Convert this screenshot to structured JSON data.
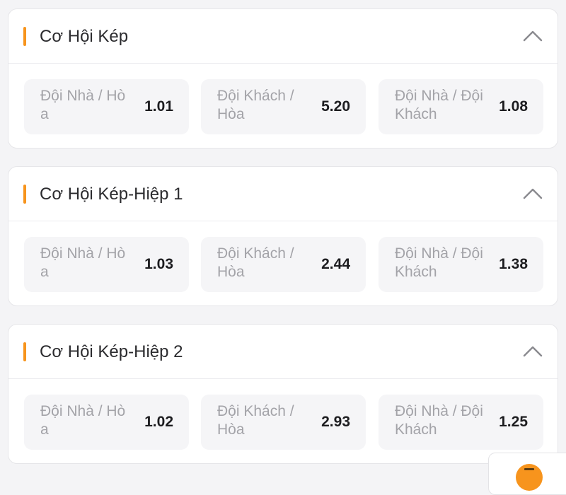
{
  "markets": [
    {
      "title": "Cơ Hội Kép",
      "odds": [
        {
          "label": "Đội Nhà / Hòa",
          "value": "1.01"
        },
        {
          "label": "Đội Khách / Hòa",
          "value": "5.20"
        },
        {
          "label": "Đội Nhà / Đội Khách",
          "value": "1.08"
        }
      ]
    },
    {
      "title": "Cơ Hội Kép-Hiệp 1",
      "odds": [
        {
          "label": "Đội Nhà / Hòa",
          "value": "1.03"
        },
        {
          "label": "Đội Khách / Hòa",
          "value": "2.44"
        },
        {
          "label": "Đội Nhà / Đội Khách",
          "value": "1.38"
        }
      ]
    },
    {
      "title": "Cơ Hội Kép-Hiệp 2",
      "odds": [
        {
          "label": "Đội Nhà / Hòa",
          "value": "1.02"
        },
        {
          "label": "Đội Khách / Hòa",
          "value": "2.93"
        },
        {
          "label": "Đội Nhà / Đội Khách",
          "value": "1.25"
        }
      ]
    }
  ],
  "icons": {
    "collapse": "chevron-up-icon",
    "floating": "menu-icon"
  },
  "colors": {
    "accent": "#f7941d",
    "card_background": "#f5f5f7",
    "label_text": "#a3a3a8",
    "value_text": "#1d1d20"
  }
}
